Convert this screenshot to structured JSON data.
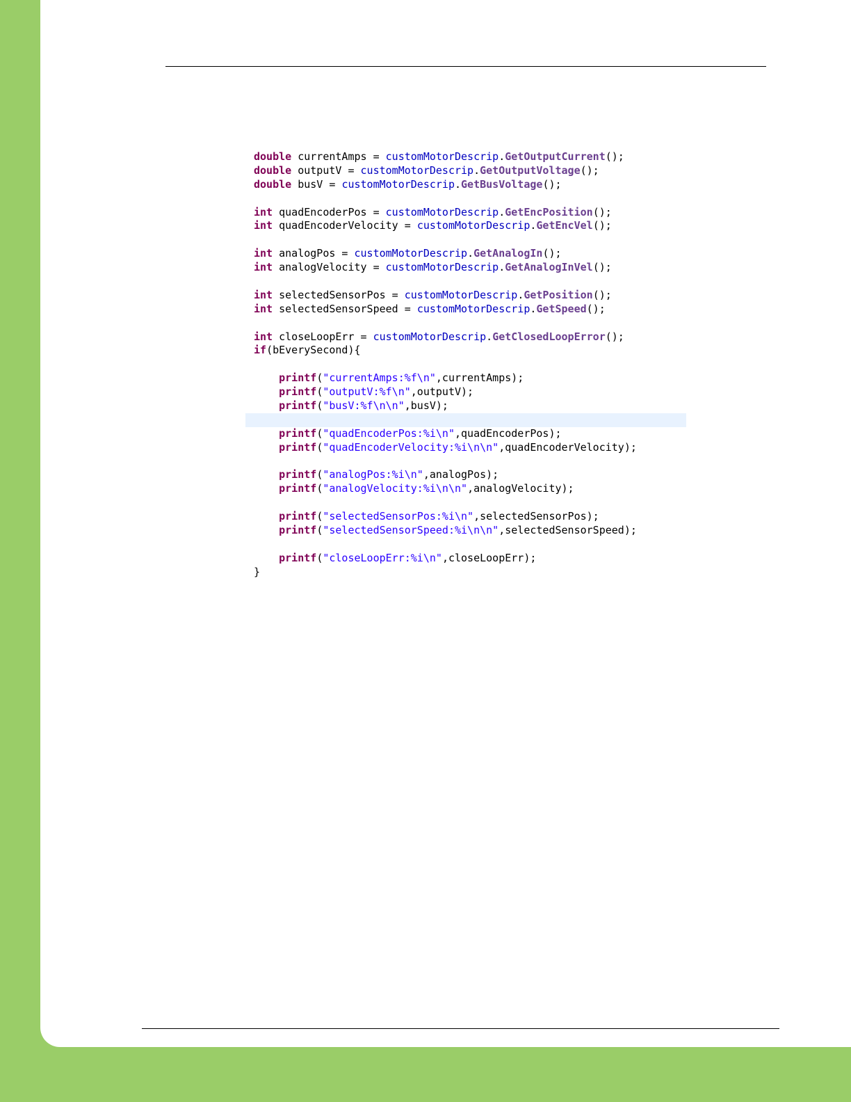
{
  "document": {
    "code": {
      "lines": [
        [
          {
            "t": "double",
            "c": "kw"
          },
          {
            "t": " currentAmps = "
          },
          {
            "t": "customMotorDescrip",
            "c": "ref"
          },
          {
            "t": "."
          },
          {
            "t": "GetOutputCurrent",
            "c": "meth"
          },
          {
            "t": "();"
          }
        ],
        [
          {
            "t": "double",
            "c": "kw"
          },
          {
            "t": " outputV = "
          },
          {
            "t": "customMotorDescrip",
            "c": "ref"
          },
          {
            "t": "."
          },
          {
            "t": "GetOutputVoltage",
            "c": "meth"
          },
          {
            "t": "();"
          }
        ],
        [
          {
            "t": "double",
            "c": "kw"
          },
          {
            "t": " busV = "
          },
          {
            "t": "customMotorDescrip",
            "c": "ref"
          },
          {
            "t": "."
          },
          {
            "t": "GetBusVoltage",
            "c": "meth"
          },
          {
            "t": "();"
          }
        ],
        [],
        [
          {
            "t": "int",
            "c": "kw"
          },
          {
            "t": " quadEncoderPos = "
          },
          {
            "t": "customMotorDescrip",
            "c": "ref"
          },
          {
            "t": "."
          },
          {
            "t": "GetEncPosition",
            "c": "meth"
          },
          {
            "t": "();"
          }
        ],
        [
          {
            "t": "int",
            "c": "kw"
          },
          {
            "t": " quadEncoderVelocity = "
          },
          {
            "t": "customMotorDescrip",
            "c": "ref"
          },
          {
            "t": "."
          },
          {
            "t": "GetEncVel",
            "c": "meth"
          },
          {
            "t": "();"
          }
        ],
        [],
        [
          {
            "t": "int",
            "c": "kw"
          },
          {
            "t": " analogPos = "
          },
          {
            "t": "customMotorDescrip",
            "c": "ref"
          },
          {
            "t": "."
          },
          {
            "t": "GetAnalogIn",
            "c": "meth"
          },
          {
            "t": "();"
          }
        ],
        [
          {
            "t": "int",
            "c": "kw"
          },
          {
            "t": " analogVelocity = "
          },
          {
            "t": "customMotorDescrip",
            "c": "ref"
          },
          {
            "t": "."
          },
          {
            "t": "GetAnalogInVel",
            "c": "meth"
          },
          {
            "t": "();"
          }
        ],
        [],
        [
          {
            "t": "int",
            "c": "kw"
          },
          {
            "t": " selectedSensorPos = "
          },
          {
            "t": "customMotorDescrip",
            "c": "ref"
          },
          {
            "t": "."
          },
          {
            "t": "GetPosition",
            "c": "meth"
          },
          {
            "t": "();"
          }
        ],
        [
          {
            "t": "int",
            "c": "kw"
          },
          {
            "t": " selectedSensorSpeed = "
          },
          {
            "t": "customMotorDescrip",
            "c": "ref"
          },
          {
            "t": "."
          },
          {
            "t": "GetSpeed",
            "c": "meth"
          },
          {
            "t": "();"
          }
        ],
        [],
        [
          {
            "t": "int",
            "c": "kw"
          },
          {
            "t": " closeLoopErr = "
          },
          {
            "t": "customMotorDescrip",
            "c": "ref"
          },
          {
            "t": "."
          },
          {
            "t": "GetClosedLoopError",
            "c": "meth"
          },
          {
            "t": "();"
          }
        ],
        [
          {
            "t": "if",
            "c": "kw"
          },
          {
            "t": "(bEverySecond){"
          }
        ],
        [],
        [
          {
            "t": "    "
          },
          {
            "t": "printf",
            "c": "kw"
          },
          {
            "t": "("
          },
          {
            "t": "\"currentAmps:%f\\n\"",
            "c": "str"
          },
          {
            "t": ",currentAmps);"
          }
        ],
        [
          {
            "t": "    "
          },
          {
            "t": "printf",
            "c": "kw"
          },
          {
            "t": "("
          },
          {
            "t": "\"outputV:%f\\n\"",
            "c": "str"
          },
          {
            "t": ",outputV);"
          }
        ],
        [
          {
            "t": "    "
          },
          {
            "t": "printf",
            "c": "kw"
          },
          {
            "t": "("
          },
          {
            "t": "\"busV:%f\\n\\n\"",
            "c": "str"
          },
          {
            "t": ",busV);"
          }
        ],
        [],
        [
          {
            "t": "    "
          },
          {
            "t": "printf",
            "c": "kw"
          },
          {
            "t": "("
          },
          {
            "t": "\"quadEncoderPos:%i\\n\"",
            "c": "str"
          },
          {
            "t": ",quadEncoderPos);"
          }
        ],
        [
          {
            "t": "    "
          },
          {
            "t": "printf",
            "c": "kw"
          },
          {
            "t": "("
          },
          {
            "t": "\"quadEncoderVelocity:%i\\n\\n\"",
            "c": "str"
          },
          {
            "t": ",quadEncoderVelocity);"
          }
        ],
        [],
        [
          {
            "t": "    "
          },
          {
            "t": "printf",
            "c": "kw"
          },
          {
            "t": "("
          },
          {
            "t": "\"analogPos:%i\\n\"",
            "c": "str"
          },
          {
            "t": ",analogPos);"
          }
        ],
        [
          {
            "t": "    "
          },
          {
            "t": "printf",
            "c": "kw"
          },
          {
            "t": "("
          },
          {
            "t": "\"analogVelocity:%i\\n\\n\"",
            "c": "str"
          },
          {
            "t": ",analogVelocity);"
          }
        ],
        [],
        [
          {
            "t": "    "
          },
          {
            "t": "printf",
            "c": "kw"
          },
          {
            "t": "("
          },
          {
            "t": "\"selectedSensorPos:%i\\n\"",
            "c": "str"
          },
          {
            "t": ",selectedSensorPos);"
          }
        ],
        [
          {
            "t": "    "
          },
          {
            "t": "printf",
            "c": "kw"
          },
          {
            "t": "("
          },
          {
            "t": "\"selectedSensorSpeed:%i\\n\\n\"",
            "c": "str"
          },
          {
            "t": ",selectedSensorSpeed);"
          }
        ],
        [],
        [
          {
            "t": "    "
          },
          {
            "t": "printf",
            "c": "kw"
          },
          {
            "t": "("
          },
          {
            "t": "\"closeLoopErr:%i\\n\"",
            "c": "str"
          },
          {
            "t": ",closeLoopErr);"
          }
        ],
        [
          {
            "t": "}"
          }
        ]
      ],
      "highlighted_line": 19
    }
  },
  "colors": {
    "page_background": "#9acd68",
    "keyword": "#7f0055",
    "field_reference": "#0000c0",
    "method": "#6a3f8f",
    "string": "#2a00ff",
    "current_line_highlight": "#e8f2fe"
  }
}
